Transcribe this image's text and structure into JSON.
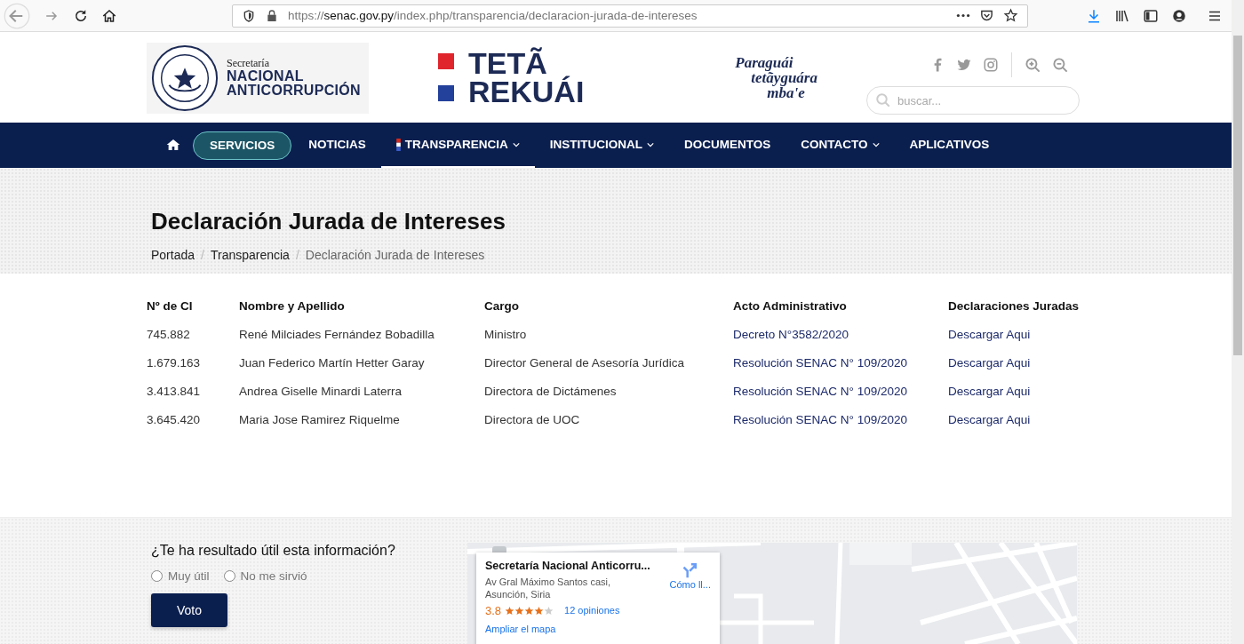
{
  "browser": {
    "url": "https://**senac.gov.py**/index.php/transparencia/declaracion-jurada-de-intereses"
  },
  "header": {
    "org_small": "Secretaría",
    "org_line1": "NACIONAL",
    "org_line2": "ANTICORRUPCIÓN",
    "campaign_line1": "TETÃ",
    "campaign_line2": "REKUÁI",
    "slogan_lines": [
      "Paraguái",
      "tetãyguára",
      "mba'e"
    ],
    "search": {
      "placeholder": "buscar..."
    }
  },
  "nav": [
    {
      "kind": "home",
      "selected": false,
      "has_dropdown": false
    },
    {
      "kind": "pill",
      "label": "SERVICIOS",
      "selected": false,
      "has_dropdown": false
    },
    {
      "kind": "link",
      "label": "NOTICIAS",
      "selected": false,
      "has_dropdown": false
    },
    {
      "kind": "link",
      "label": "TRANSPARENCIA",
      "selected": true,
      "has_dropdown": true
    },
    {
      "kind": "link",
      "label": "INSTITUCIONAL",
      "selected": false,
      "has_dropdown": true
    },
    {
      "kind": "link",
      "label": "DOCUMENTOS",
      "selected": false,
      "has_dropdown": false
    },
    {
      "kind": "link",
      "label": "CONTACTO",
      "selected": false,
      "has_dropdown": true
    },
    {
      "kind": "link",
      "label": "APLICATIVOS",
      "selected": false,
      "has_dropdown": false
    }
  ],
  "page": {
    "title": "Declaración Jurada de Intereses",
    "breadcrumb": {
      "separator": "/",
      "items": [
        "Portada",
        "Transparencia",
        "Declaración Jurada de Intereses"
      ]
    }
  },
  "table": {
    "columns": [
      "Nº de CI",
      "Nombre y Apellido",
      "Cargo",
      "Acto Administrativo",
      "Declaraciones Juradas"
    ],
    "rows": [
      [
        "745.882",
        "René Milciades Fernández Bobadilla",
        "Ministro",
        "Decreto N°3582/2020",
        "Descargar Aqui"
      ],
      [
        "1.679.163",
        "Juan Federico Martín Hetter Garay",
        "Director General de Asesoría Jurídica",
        "Resolución SENAC N° 109/2020",
        "Descargar Aqui"
      ],
      [
        "3.413.841",
        "Andrea Giselle Minardi Laterra",
        "Directora de Dictámenes",
        "Resolución SENAC N° 109/2020",
        "Descargar Aqui"
      ],
      [
        "3.645.420",
        "Maria Jose Ramirez Riquelme",
        "Directora de UOC",
        "Resolución SENAC N° 109/2020",
        "Descargar Aqui"
      ]
    ]
  },
  "feedback": {
    "question": "¿Te ha resultado útil esta información?",
    "options": [
      {
        "label": "Muy útil",
        "selected": false
      },
      {
        "label": "No me sirvió",
        "selected": false
      }
    ],
    "button": "Voto"
  },
  "map": {
    "card": {
      "title": "Secretaría Nacional Anticorru...",
      "address_lines": [
        "Av Gral Máximo Santos casi,",
        "Asunción, Siria"
      ],
      "rating": "3.8",
      "stars": 4,
      "reviews": "12 opiniones",
      "directions": "Cómo ll...",
      "enlarge": "Ampliar el mapa"
    }
  }
}
